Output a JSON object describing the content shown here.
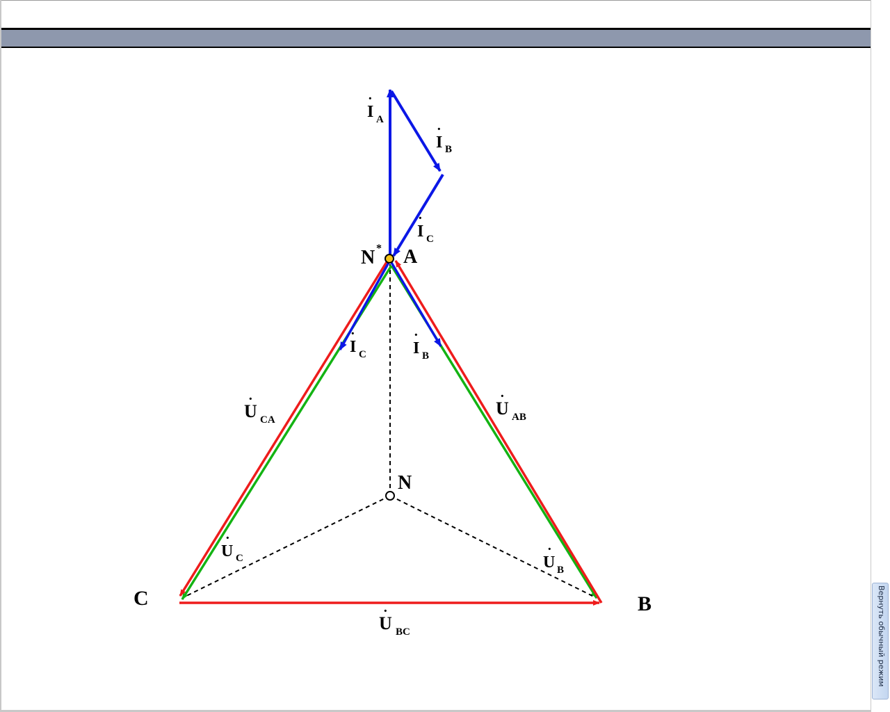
{
  "vectors": {
    "I_A": {
      "main": "I",
      "sub": "A"
    },
    "I_B_top": {
      "main": "I",
      "sub": "B"
    },
    "I_C_top": {
      "main": "I",
      "sub": "C"
    },
    "I_C_low": {
      "main": "I",
      "sub": "C"
    },
    "I_B_low": {
      "main": "I",
      "sub": "B"
    },
    "U_CA": {
      "main": "U",
      "sub": "CA"
    },
    "U_AB": {
      "main": "U",
      "sub": "AB"
    },
    "U_C": {
      "main": "U",
      "sub": "C"
    },
    "U_B": {
      "main": "U",
      "sub": "B"
    },
    "U_BC": {
      "main": "U",
      "sub": "BC"
    }
  },
  "points": {
    "n_star": {
      "main": "N",
      "sup": "*"
    },
    "a": "A",
    "n": "N",
    "c": "C",
    "b": "B"
  },
  "colors": {
    "line_voltage": "#ee1c1c",
    "phase_voltage": "#13b313",
    "current": "#0b17e6",
    "neutral_shift_point": "#f5c518",
    "titlebar": "#8e98ad"
  },
  "side_panel": {
    "restore_label": "Вернуть обычный режим"
  }
}
